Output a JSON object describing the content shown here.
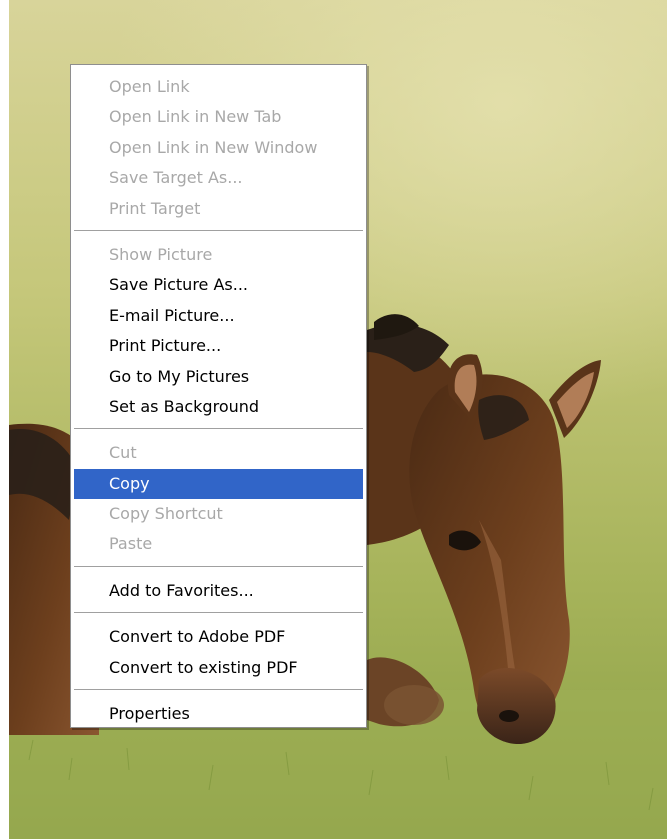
{
  "context_menu": {
    "groups": [
      {
        "items": [
          {
            "label": "Open Link",
            "enabled": false
          },
          {
            "label": "Open Link in New Tab",
            "enabled": false
          },
          {
            "label": "Open Link in New Window",
            "enabled": false
          },
          {
            "label": "Save Target As...",
            "enabled": false
          },
          {
            "label": "Print Target",
            "enabled": false
          }
        ]
      },
      {
        "items": [
          {
            "label": "Show Picture",
            "enabled": false
          },
          {
            "label": "Save Picture As...",
            "enabled": true
          },
          {
            "label": "E-mail Picture...",
            "enabled": true
          },
          {
            "label": "Print Picture...",
            "enabled": true
          },
          {
            "label": "Go to My Pictures",
            "enabled": true
          },
          {
            "label": "Set as Background",
            "enabled": true
          }
        ]
      },
      {
        "items": [
          {
            "label": "Cut",
            "enabled": false
          },
          {
            "label": "Copy",
            "enabled": true,
            "highlighted": true
          },
          {
            "label": "Copy Shortcut",
            "enabled": false
          },
          {
            "label": "Paste",
            "enabled": false
          }
        ]
      },
      {
        "items": [
          {
            "label": "Add to Favorites...",
            "enabled": true
          }
        ]
      },
      {
        "items": [
          {
            "label": "Convert to Adobe PDF",
            "enabled": true
          },
          {
            "label": "Convert to existing PDF",
            "enabled": true
          }
        ]
      },
      {
        "items": [
          {
            "label": "Properties",
            "enabled": true
          }
        ]
      }
    ],
    "colors": {
      "highlight": "#3165c8",
      "disabled_text": "#a8a8a8",
      "enabled_text": "#000000",
      "menu_background": "#ffffff",
      "border": "#8e8e8e"
    }
  },
  "background": {
    "subject_icon": "horse-photo",
    "colors": {
      "grass_light": "#d6d891",
      "grass_mid": "#a8b458",
      "grass_dark": "#6f8a31",
      "horse_coat": "#6b3e1f",
      "horse_mane": "#2a2018"
    }
  }
}
